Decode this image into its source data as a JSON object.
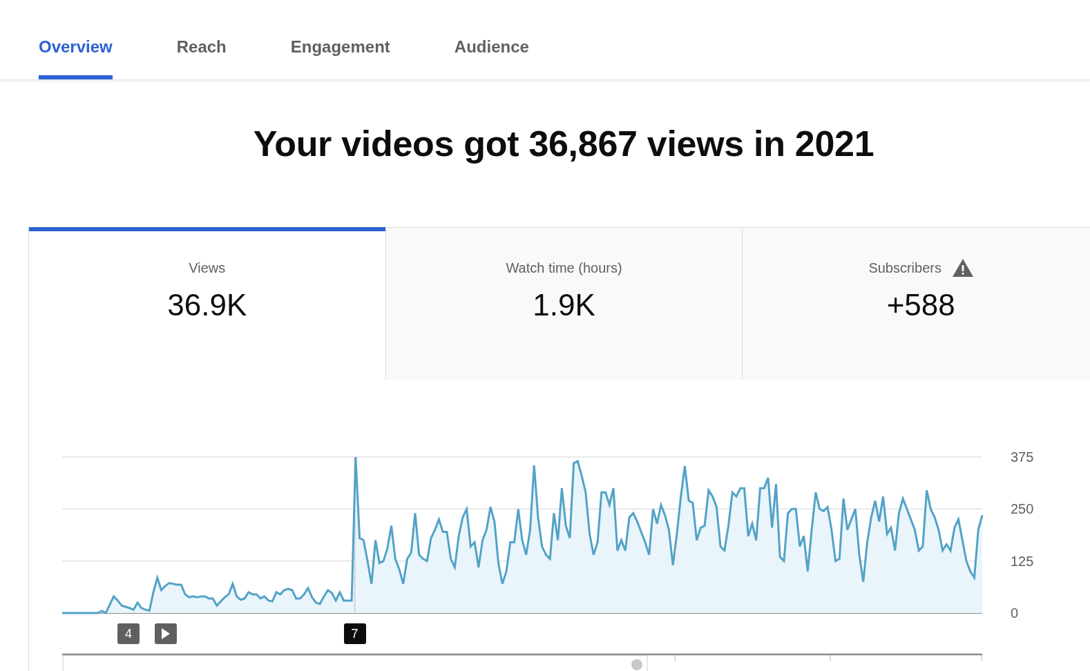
{
  "tabs": [
    {
      "label": "Overview",
      "selected": true
    },
    {
      "label": "Reach",
      "selected": false
    },
    {
      "label": "Engagement",
      "selected": false
    },
    {
      "label": "Audience",
      "selected": false
    }
  ],
  "headline": "Your videos got 36,867 views in 2021",
  "metrics": [
    {
      "label": "Views",
      "value": "36.9K",
      "selected": true,
      "warning": false
    },
    {
      "label": "Watch time (hours)",
      "value": "1.9K",
      "selected": false,
      "warning": false
    },
    {
      "label": "Subscribers",
      "value": "+588",
      "selected": false,
      "warning": true
    }
  ],
  "chart": {
    "chart_data": {
      "type": "area",
      "ylim": [
        0,
        375
      ],
      "yticks": [
        0,
        125,
        250,
        375
      ],
      "values": [
        0,
        0,
        0,
        0,
        0,
        0,
        0,
        0,
        0,
        0,
        5,
        0,
        20,
        40,
        30,
        18,
        15,
        12,
        8,
        25,
        12,
        8,
        6,
        50,
        85,
        55,
        65,
        72,
        70,
        68,
        68,
        45,
        38,
        40,
        38,
        40,
        40,
        35,
        35,
        18,
        28,
        38,
        45,
        70,
        40,
        32,
        35,
        50,
        45,
        45,
        35,
        40,
        30,
        28,
        50,
        45,
        55,
        58,
        55,
        35,
        35,
        45,
        60,
        38,
        25,
        22,
        40,
        55,
        48,
        30,
        50,
        30,
        30,
        30,
        375,
        180,
        175,
        125,
        70,
        175,
        120,
        125,
        155,
        210,
        130,
        105,
        70,
        130,
        145,
        240,
        140,
        130,
        125,
        180,
        200,
        225,
        195,
        195,
        130,
        110,
        185,
        230,
        250,
        160,
        170,
        110,
        175,
        200,
        255,
        220,
        120,
        70,
        100,
        170,
        170,
        250,
        175,
        140,
        200,
        355,
        230,
        160,
        140,
        130,
        240,
        175,
        300,
        210,
        180,
        360,
        365,
        330,
        290,
        190,
        140,
        170,
        290,
        290,
        260,
        300,
        150,
        175,
        150,
        230,
        240,
        220,
        195,
        170,
        140,
        250,
        215,
        260,
        235,
        200,
        115,
        190,
        280,
        353,
        270,
        265,
        175,
        205,
        210,
        295,
        280,
        255,
        160,
        150,
        210,
        290,
        280,
        300,
        300,
        185,
        215,
        175,
        300,
        300,
        325,
        205,
        310,
        135,
        125,
        240,
        250,
        250,
        160,
        185,
        100,
        200,
        290,
        250,
        245,
        255,
        200,
        125,
        130,
        275,
        200,
        225,
        250,
        140,
        75,
        170,
        230,
        270,
        220,
        280,
        190,
        205,
        150,
        240,
        275,
        250,
        225,
        200,
        150,
        160,
        295,
        250,
        230,
        200,
        150,
        165,
        150,
        205,
        225,
        175,
        125,
        100,
        85,
        200,
        235
      ]
    },
    "markers": [
      {
        "kind": "number",
        "label": "4",
        "selected": false
      },
      {
        "kind": "video",
        "selected": false
      },
      {
        "kind": "number",
        "label": "7",
        "selected": true
      }
    ]
  }
}
